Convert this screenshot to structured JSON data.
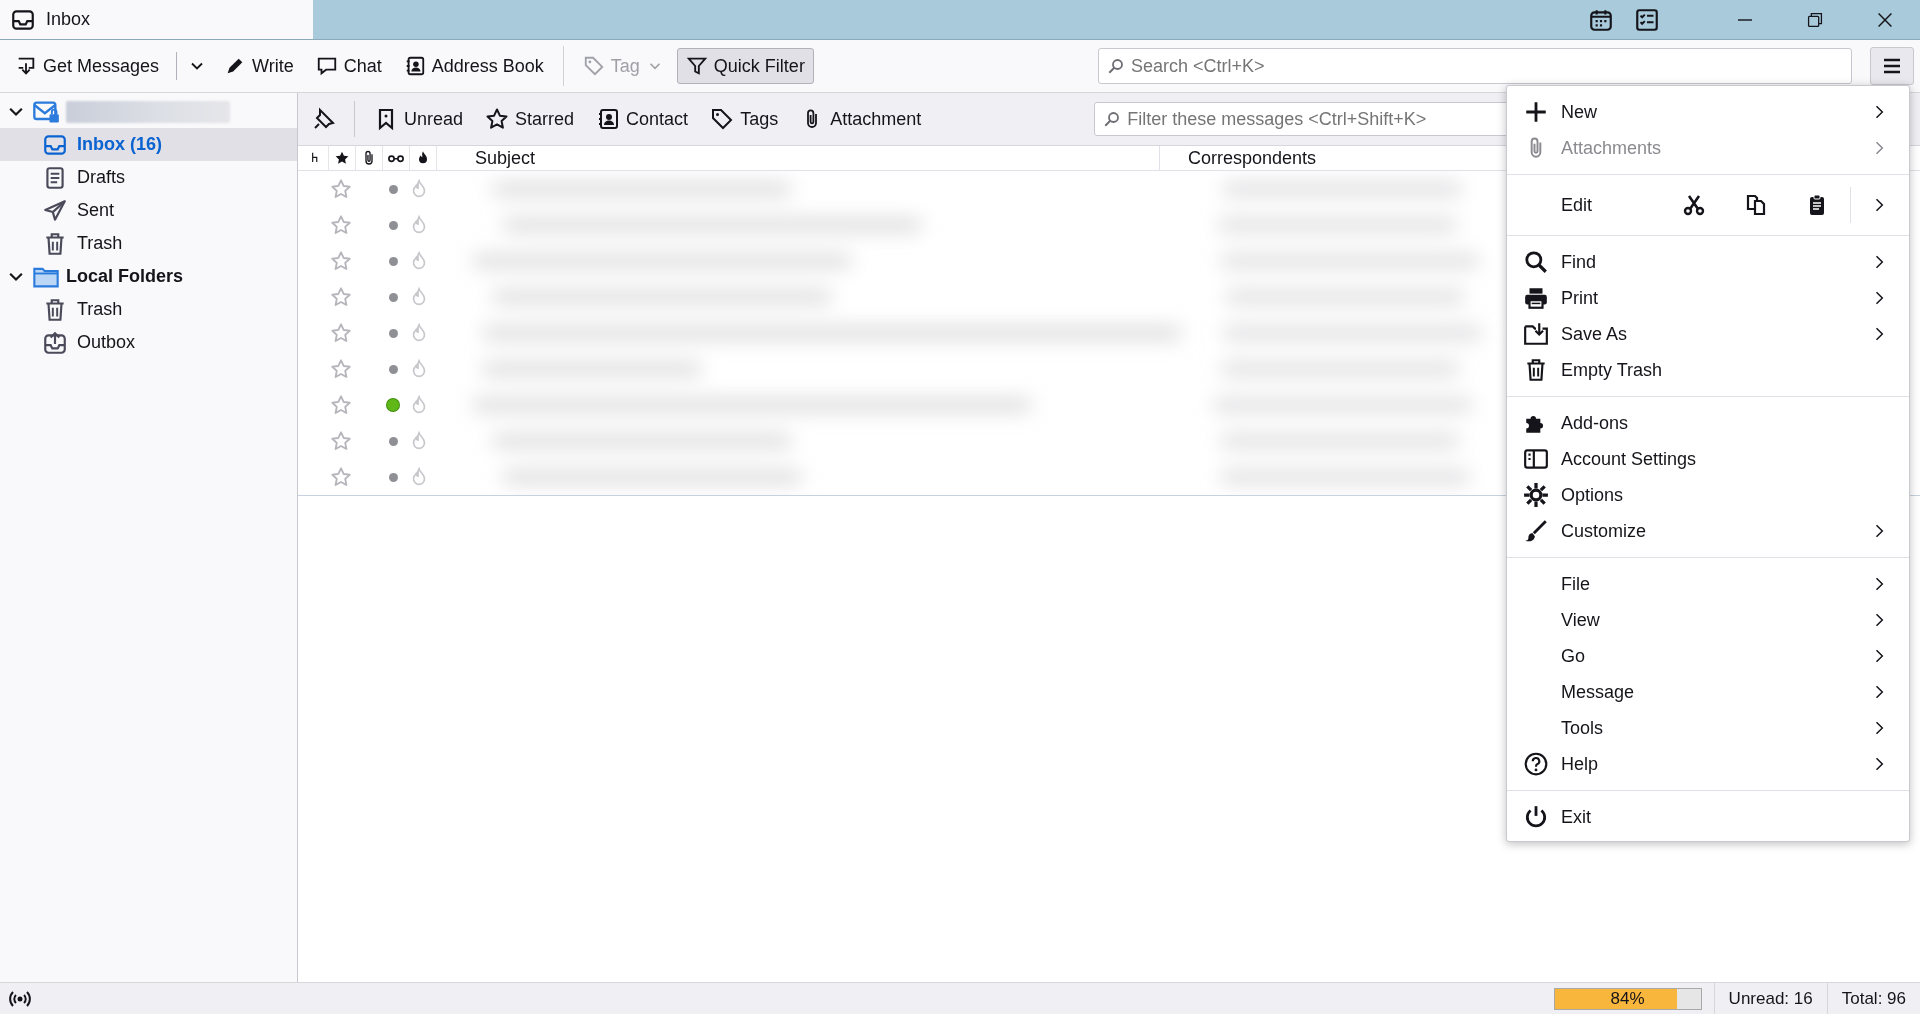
{
  "window": {
    "title": "Inbox"
  },
  "toolbar": {
    "groups": [
      [
        {
          "label": "Get Messages",
          "kind": "split",
          "disabled": false,
          "selected": false
        },
        {
          "label": "Write",
          "kind": "plain",
          "disabled": false,
          "selected": false
        },
        {
          "label": "Chat",
          "kind": "plain",
          "disabled": false,
          "selected": false
        },
        {
          "label": "Address Book",
          "kind": "plain",
          "disabled": false,
          "selected": false
        }
      ],
      [
        {
          "label": "Tag",
          "kind": "menu",
          "disabled": true,
          "selected": false
        },
        {
          "label": "Quick Filter",
          "kind": "plain",
          "disabled": false,
          "selected": true
        }
      ]
    ],
    "search": {
      "placeholder": "Search <Ctrl+K>"
    }
  },
  "folders": [
    {
      "kind": "account",
      "expanded": true,
      "children": [
        {
          "label": "Inbox (16)",
          "selected": true
        },
        {
          "label": "Drafts",
          "selected": false
        },
        {
          "label": "Sent",
          "selected": false
        },
        {
          "label": "Trash",
          "selected": false
        }
      ]
    },
    {
      "kind": "local",
      "label": "Local Folders",
      "expanded": true,
      "children": [
        {
          "label": "Trash",
          "selected": false
        },
        {
          "label": "Outbox",
          "selected": false
        }
      ]
    }
  ],
  "quick_filter": {
    "toggles": [
      {
        "label": "Unread",
        "selected": false
      },
      {
        "label": "Starred",
        "selected": false
      },
      {
        "label": "Contact",
        "selected": false
      },
      {
        "label": "Tags",
        "selected": false
      },
      {
        "label": "Attachment",
        "selected": false
      }
    ],
    "placeholder": "Filter these messages <Ctrl+Shift+K>"
  },
  "columns": [
    {
      "label": "Subject"
    },
    {
      "label": "Correspondents"
    }
  ],
  "messages": [
    {
      "starred": false,
      "unread": false
    },
    {
      "starred": false,
      "unread": false
    },
    {
      "starred": false,
      "unread": false
    },
    {
      "starred": false,
      "unread": false
    },
    {
      "starred": false,
      "unread": false
    },
    {
      "starred": false,
      "unread": false
    },
    {
      "starred": false,
      "unread": true
    },
    {
      "starred": false,
      "unread": false
    },
    {
      "starred": false,
      "unread": false
    }
  ],
  "menu": {
    "items": [
      {
        "kind": "item",
        "label": "New",
        "submenu": true
      },
      {
        "kind": "item",
        "label": "Attachments",
        "submenu": true,
        "disabled": true
      },
      {
        "kind": "separator"
      },
      {
        "kind": "edit",
        "label": "Edit",
        "submenu": true
      },
      {
        "kind": "separator"
      },
      {
        "kind": "item",
        "label": "Find",
        "submenu": true
      },
      {
        "kind": "item",
        "label": "Print",
        "submenu": true
      },
      {
        "kind": "item",
        "label": "Save As",
        "submenu": true
      },
      {
        "kind": "item",
        "label": "Empty Trash",
        "submenu": false
      },
      {
        "kind": "separator"
      },
      {
        "kind": "item",
        "label": "Add-ons",
        "submenu": false
      },
      {
        "kind": "item",
        "label": "Account Settings",
        "submenu": false
      },
      {
        "kind": "item",
        "label": "Options",
        "submenu": false
      },
      {
        "kind": "item",
        "label": "Customize",
        "submenu": true
      },
      {
        "kind": "separator"
      },
      {
        "kind": "item",
        "label": "File",
        "submenu": true
      },
      {
        "kind": "item",
        "label": "View",
        "submenu": true
      },
      {
        "kind": "item",
        "label": "Go",
        "submenu": true
      },
      {
        "kind": "item",
        "label": "Message",
        "submenu": true
      },
      {
        "kind": "item",
        "label": "Tools",
        "submenu": true
      },
      {
        "kind": "item",
        "label": "Help",
        "submenu": true
      },
      {
        "kind": "separator"
      },
      {
        "kind": "item",
        "label": "Exit",
        "submenu": false
      }
    ]
  },
  "status_bar": {
    "progress": {
      "level": 0.84,
      "label": "84%"
    },
    "unread": "Unread: 16",
    "total": "Total: 96"
  }
}
